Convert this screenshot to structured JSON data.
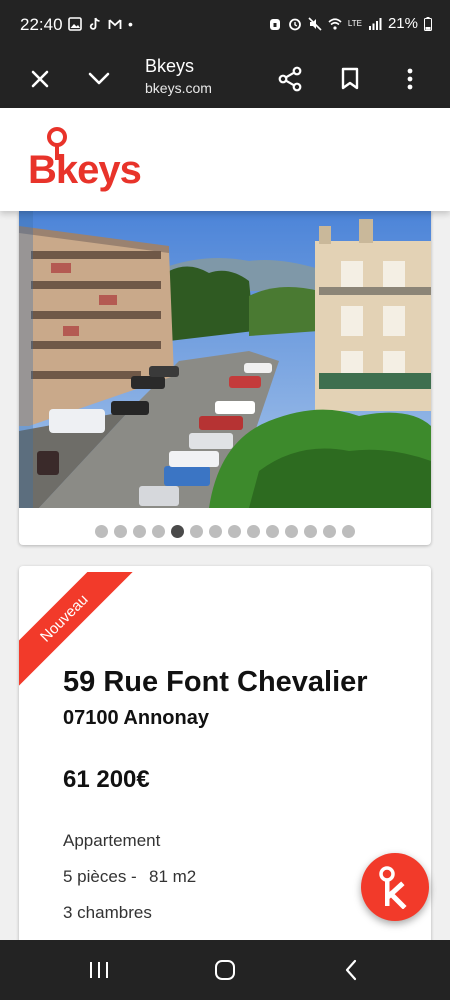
{
  "status_bar": {
    "time": "22:40",
    "dot": "•",
    "battery": "21%",
    "network": "LTE"
  },
  "toolbar": {
    "title": "Bkeys",
    "url": "bkeys.com"
  },
  "site": {
    "logo_text": "Bkeys",
    "brand_color": "#e8332a"
  },
  "gallery": {
    "photo_count": 14,
    "active_index": 4
  },
  "listing": {
    "badge": "Nouveau",
    "address": "59 Rue Font Chevalier",
    "city": "07100 Annonay",
    "price": "61 200€",
    "property_type": "Appartement",
    "rooms": "5 pièces -",
    "area": "81 m2",
    "bedrooms": "3 chambres"
  },
  "fab": {
    "icon": "bkeys-k-icon",
    "color": "#f23a2a"
  }
}
